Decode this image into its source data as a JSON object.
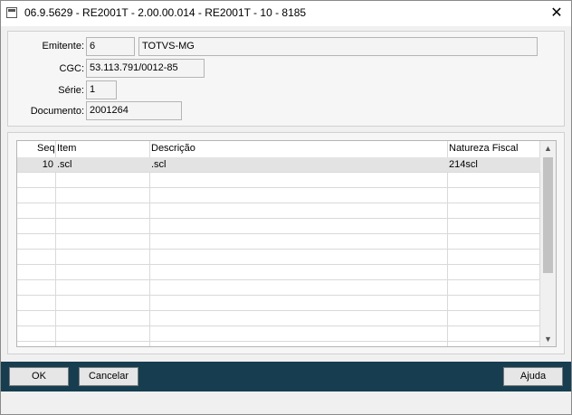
{
  "window": {
    "title": "06.9.5629 - RE2001T - 2.00.00.014 - RE2001T - 10 - 8185",
    "close_glyph": "✕"
  },
  "header": {
    "emitente": {
      "label": "Emitente:",
      "code": "6",
      "name": "TOTVS-MG"
    },
    "cgc": {
      "label": "CGC:",
      "value": "53.113.791/0012-85"
    },
    "serie": {
      "label": "Série:",
      "value": "1"
    },
    "documento": {
      "label": "Documento:",
      "value": "2001264"
    }
  },
  "grid": {
    "columns": [
      "Seq",
      "Item",
      "Descrição",
      "Natureza Fiscal"
    ],
    "rows": [
      {
        "seq": "10",
        "item": ".scl",
        "descricao": ".scl",
        "natureza": "214scl"
      }
    ]
  },
  "footer": {
    "ok_label": "OK",
    "cancel_label": "Cancelar",
    "help_label": "Ajuda"
  },
  "colors": {
    "footer_bg": "#163e50",
    "selected_row": "#e3e3e3"
  }
}
